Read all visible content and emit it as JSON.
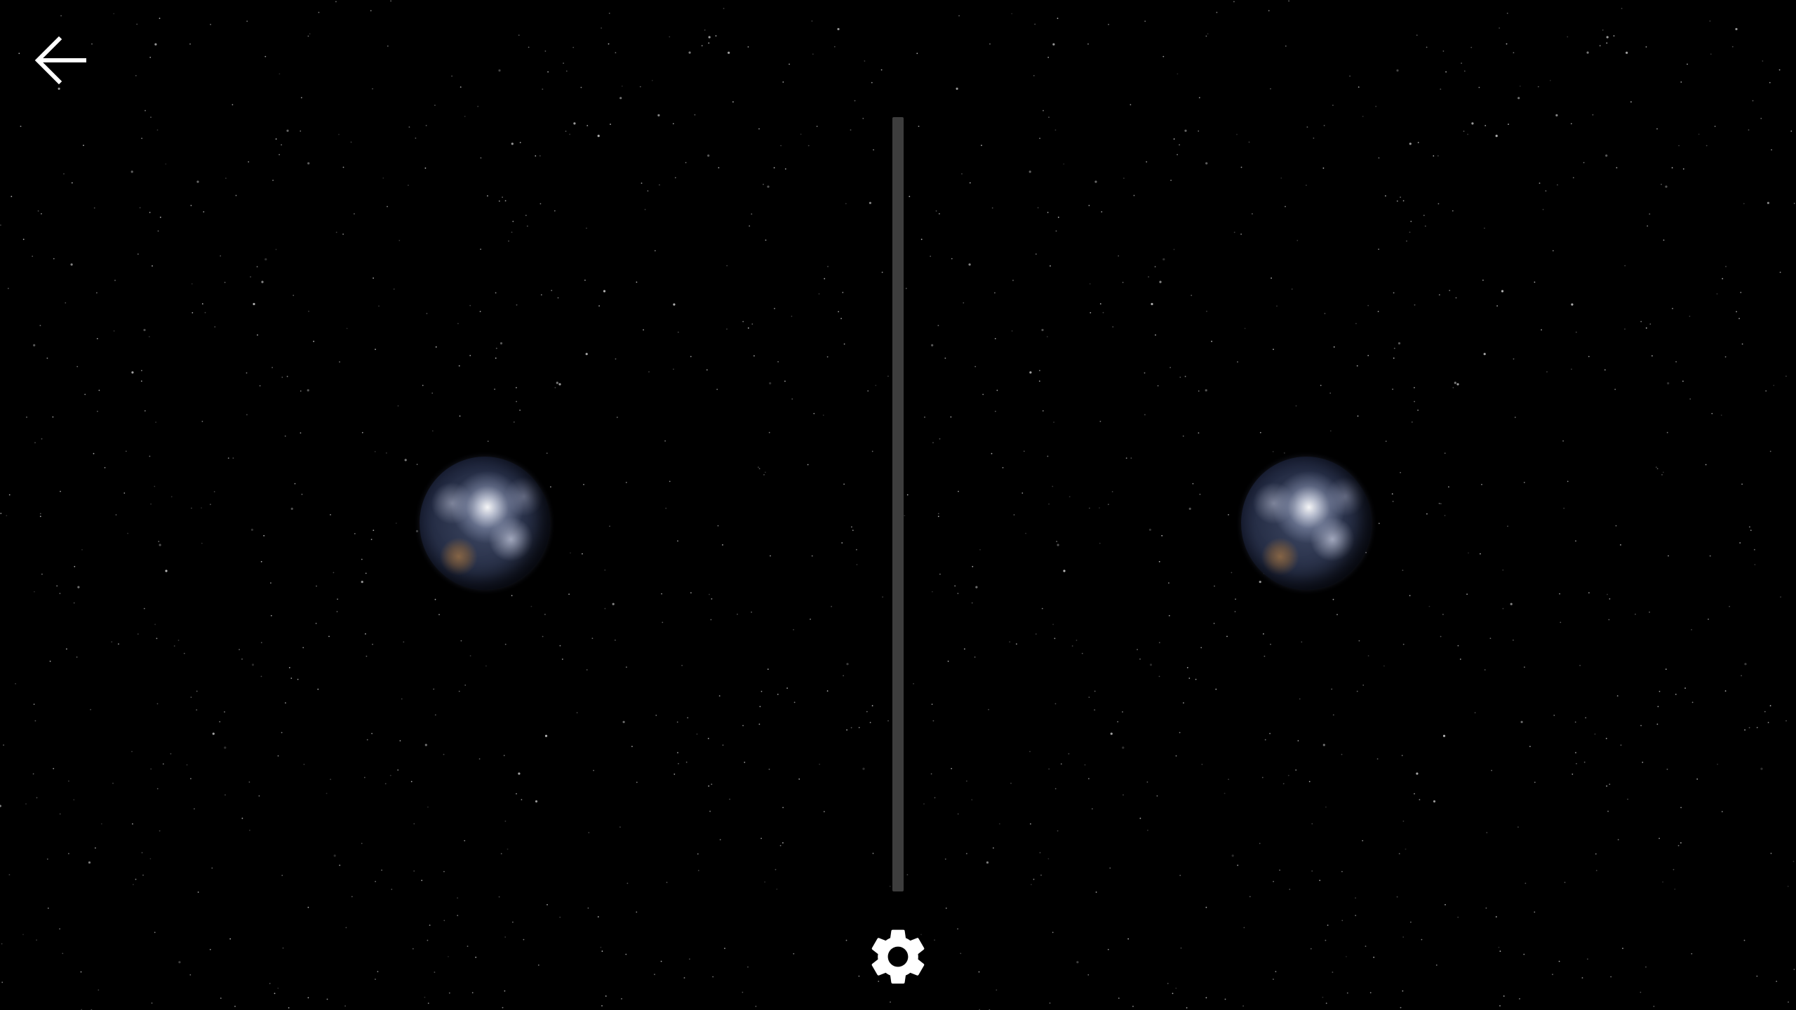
{
  "app": {
    "mode": "vr-split-screen",
    "background_color": "#000000",
    "divider_color": "#3d3d3d"
  },
  "toolbar": {
    "back_icon": "arrow-left-icon",
    "settings_icon": "gear-icon"
  },
  "scene": {
    "object": "earth-globe",
    "views": [
      "left-eye",
      "right-eye"
    ]
  }
}
